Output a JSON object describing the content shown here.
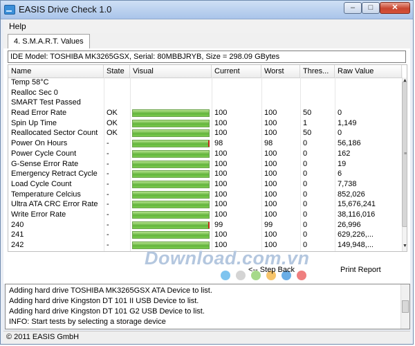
{
  "window": {
    "title": "EASIS Drive Check 1.0",
    "minimize": "–",
    "maximize": "□",
    "close": "✕"
  },
  "menu": {
    "help": "Help"
  },
  "tab": {
    "label": "4. S.M.A.R.T. Values"
  },
  "drive_info": "IDE Model: TOSHIBA MK3265GSX, Serial: 80MBBJRYB, Size = 298.09 GBytes",
  "table": {
    "columns": [
      "Name",
      "State",
      "Visual",
      "Current",
      "Worst",
      "Thres...",
      "Raw Value"
    ],
    "rows": [
      {
        "name": "Temp 58°C",
        "state": "",
        "bar": 0,
        "current": "",
        "worst": "",
        "thres": "",
        "raw": ""
      },
      {
        "name": "Realloc Sec 0",
        "state": "",
        "bar": 0,
        "current": "",
        "worst": "",
        "thres": "",
        "raw": ""
      },
      {
        "name": "SMART Test Passed",
        "state": "",
        "bar": 0,
        "current": "",
        "worst": "",
        "thres": "",
        "raw": ""
      },
      {
        "name": "Read Error Rate",
        "state": "OK",
        "bar": 1,
        "current": "100",
        "worst": "100",
        "thres": "50",
        "raw": "0"
      },
      {
        "name": "Spin Up Time",
        "state": "OK",
        "bar": 1,
        "current": "100",
        "worst": "100",
        "thres": "1",
        "raw": "1,149"
      },
      {
        "name": "Reallocated Sector Count",
        "state": "OK",
        "bar": 1,
        "current": "100",
        "worst": "100",
        "thres": "50",
        "raw": "0"
      },
      {
        "name": "Power On Hours",
        "state": "-",
        "bar": 1,
        "current": "98",
        "worst": "98",
        "thres": "0",
        "raw": "56,186",
        "tick": true
      },
      {
        "name": "Power Cycle Count",
        "state": "-",
        "bar": 1,
        "current": "100",
        "worst": "100",
        "thres": "0",
        "raw": "162"
      },
      {
        "name": "G-Sense Error Rate",
        "state": "-",
        "bar": 1,
        "current": "100",
        "worst": "100",
        "thres": "0",
        "raw": "19"
      },
      {
        "name": "Emergency Retract Cycle",
        "state": "-",
        "bar": 1,
        "current": "100",
        "worst": "100",
        "thres": "0",
        "raw": "6"
      },
      {
        "name": "Load Cycle Count",
        "state": "-",
        "bar": 1,
        "current": "100",
        "worst": "100",
        "thres": "0",
        "raw": "7,738"
      },
      {
        "name": "Temperature Celcius",
        "state": "-",
        "bar": 1,
        "current": "100",
        "worst": "100",
        "thres": "0",
        "raw": "852,026"
      },
      {
        "name": "Ultra ATA CRC Error Rate",
        "state": "-",
        "bar": 1,
        "current": "100",
        "worst": "100",
        "thres": "0",
        "raw": "15,676,241"
      },
      {
        "name": "Write Error Rate",
        "state": "-",
        "bar": 1,
        "current": "100",
        "worst": "100",
        "thres": "0",
        "raw": "38,116,016"
      },
      {
        "name": "240",
        "state": "-",
        "bar": 1,
        "current": "99",
        "worst": "99",
        "thres": "0",
        "raw": "26,996",
        "tick": true
      },
      {
        "name": "241",
        "state": "-",
        "bar": 1,
        "current": "100",
        "worst": "100",
        "thres": "0",
        "raw": "629,226,..."
      },
      {
        "name": "242",
        "state": "-",
        "bar": 1,
        "current": "100",
        "worst": "100",
        "thres": "0",
        "raw": "149,948,..."
      }
    ]
  },
  "buttons": {
    "step_back": "<-- Step Back",
    "print_report": "Print Report"
  },
  "watermark": "Download.com.vn",
  "watermark_dots": [
    "#7fc4ef",
    "#d4d4d4",
    "#a6d98a",
    "#f6c46a",
    "#6aaee6",
    "#ef7f7f"
  ],
  "log": [
    "Adding hard drive TOSHIBA MK3265GSX ATA Device to list.",
    "Adding hard drive Kingston DT 101 II USB Device to list.",
    "Adding hard drive Kingston DT 101 G2 USB Device to list.",
    "INFO: Start tests by selecting a storage device"
  ],
  "status": "© 2011 EASIS GmbH"
}
